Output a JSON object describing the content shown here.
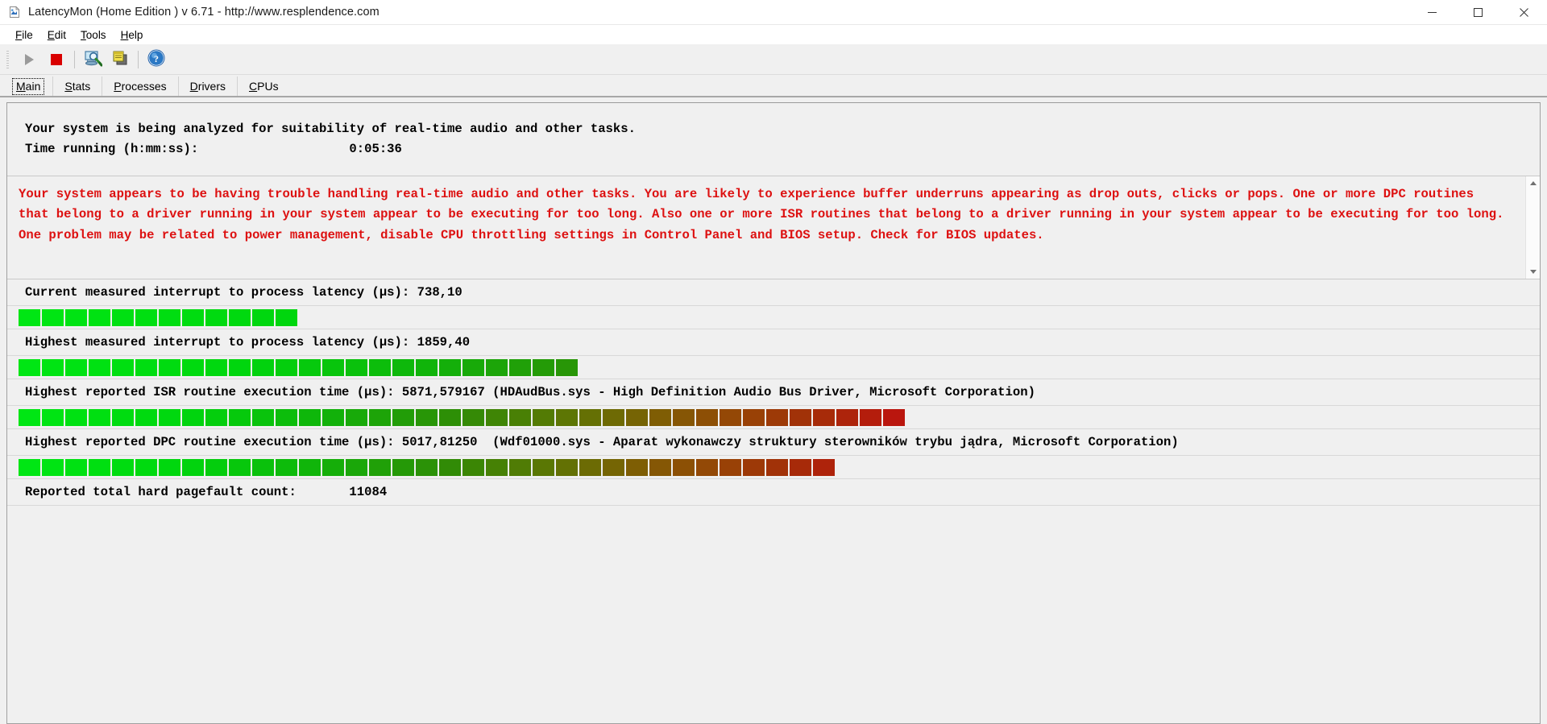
{
  "window": {
    "title": "LatencyMon  (Home Edition )  v 6.71 - http://www.resplendence.com",
    "icon": "latencymon-app-icon",
    "minimize_label": "Minimize",
    "maximize_label": "Maximize",
    "close_label": "Close"
  },
  "menu": {
    "items": [
      {
        "label": "File",
        "accel": "F"
      },
      {
        "label": "Edit",
        "accel": "E"
      },
      {
        "label": "Tools",
        "accel": "T"
      },
      {
        "label": "Help",
        "accel": "H"
      }
    ]
  },
  "toolbar": {
    "buttons": [
      {
        "name": "start-monitoring-button",
        "icon": "play-icon",
        "enabled": false
      },
      {
        "name": "stop-monitoring-button",
        "icon": "stop-icon",
        "enabled": true
      },
      {
        "name": "system-info-button",
        "icon": "monitor-magnifier-icon",
        "enabled": true
      },
      {
        "name": "windows-list-button",
        "icon": "cascade-windows-icon",
        "enabled": true
      },
      {
        "name": "help-button",
        "icon": "help-question-icon",
        "enabled": true
      }
    ]
  },
  "tabs": {
    "active": "Main",
    "items": [
      {
        "label": "Main",
        "accel": "M"
      },
      {
        "label": "Stats",
        "accel": "S"
      },
      {
        "label": "Processes",
        "accel": "P"
      },
      {
        "label": "Drivers",
        "accel": "D"
      },
      {
        "label": "CPUs",
        "accel": "C"
      }
    ]
  },
  "main": {
    "analysis_headline": "Your system is being analyzed for suitability of real-time audio and other tasks.",
    "time_running_label": "Time running (h:mm:ss):",
    "time_running_value": "0:05:36",
    "warning_color": "#dd1111",
    "warning_text": "Your system appears to be having trouble handling real-time audio and other tasks. You are likely to experience buffer underruns appearing as drop outs, clicks or pops. One or more DPC routines that belong to a driver running in your system appear to be executing for too long. Also one or more ISR routines that belong to a driver running in your system appear to be executing for too long. One problem may be related to power management, disable CPU throttling settings in Control Panel and BIOS setup. Check for BIOS updates.",
    "metrics": [
      {
        "label": "Current measured interrupt to process latency (µs):",
        "value": "738,10",
        "extra": "",
        "bar_segments": 12,
        "bar_end_hue": 0.18
      },
      {
        "label": "Highest measured interrupt to process latency (µs):",
        "value": "1859,40",
        "extra": "",
        "bar_segments": 24,
        "bar_end_hue": 0.46
      },
      {
        "label": "Highest reported ISR routine execution time (µs):",
        "value": "5871,579167",
        "extra": "(HDAudBus.sys - High Definition Audio Bus Driver, Microsoft Corporation)",
        "bar_segments": 38,
        "bar_end_hue": 1.0
      },
      {
        "label": "Highest reported DPC routine execution time (µs):",
        "value": "5017,81250",
        "extra": "(Wdf01000.sys - Aparat wykonawczy struktury sterowników trybu jądra, Microsoft Corporation)",
        "bar_segments": 35,
        "bar_end_hue": 0.95
      }
    ],
    "pagefault_label": "Reported total hard pagefault count:",
    "pagefault_value": "11084"
  },
  "scrollbar": {
    "up_arrow": "scroll-up-arrow",
    "down_arrow": "scroll-down-arrow"
  }
}
